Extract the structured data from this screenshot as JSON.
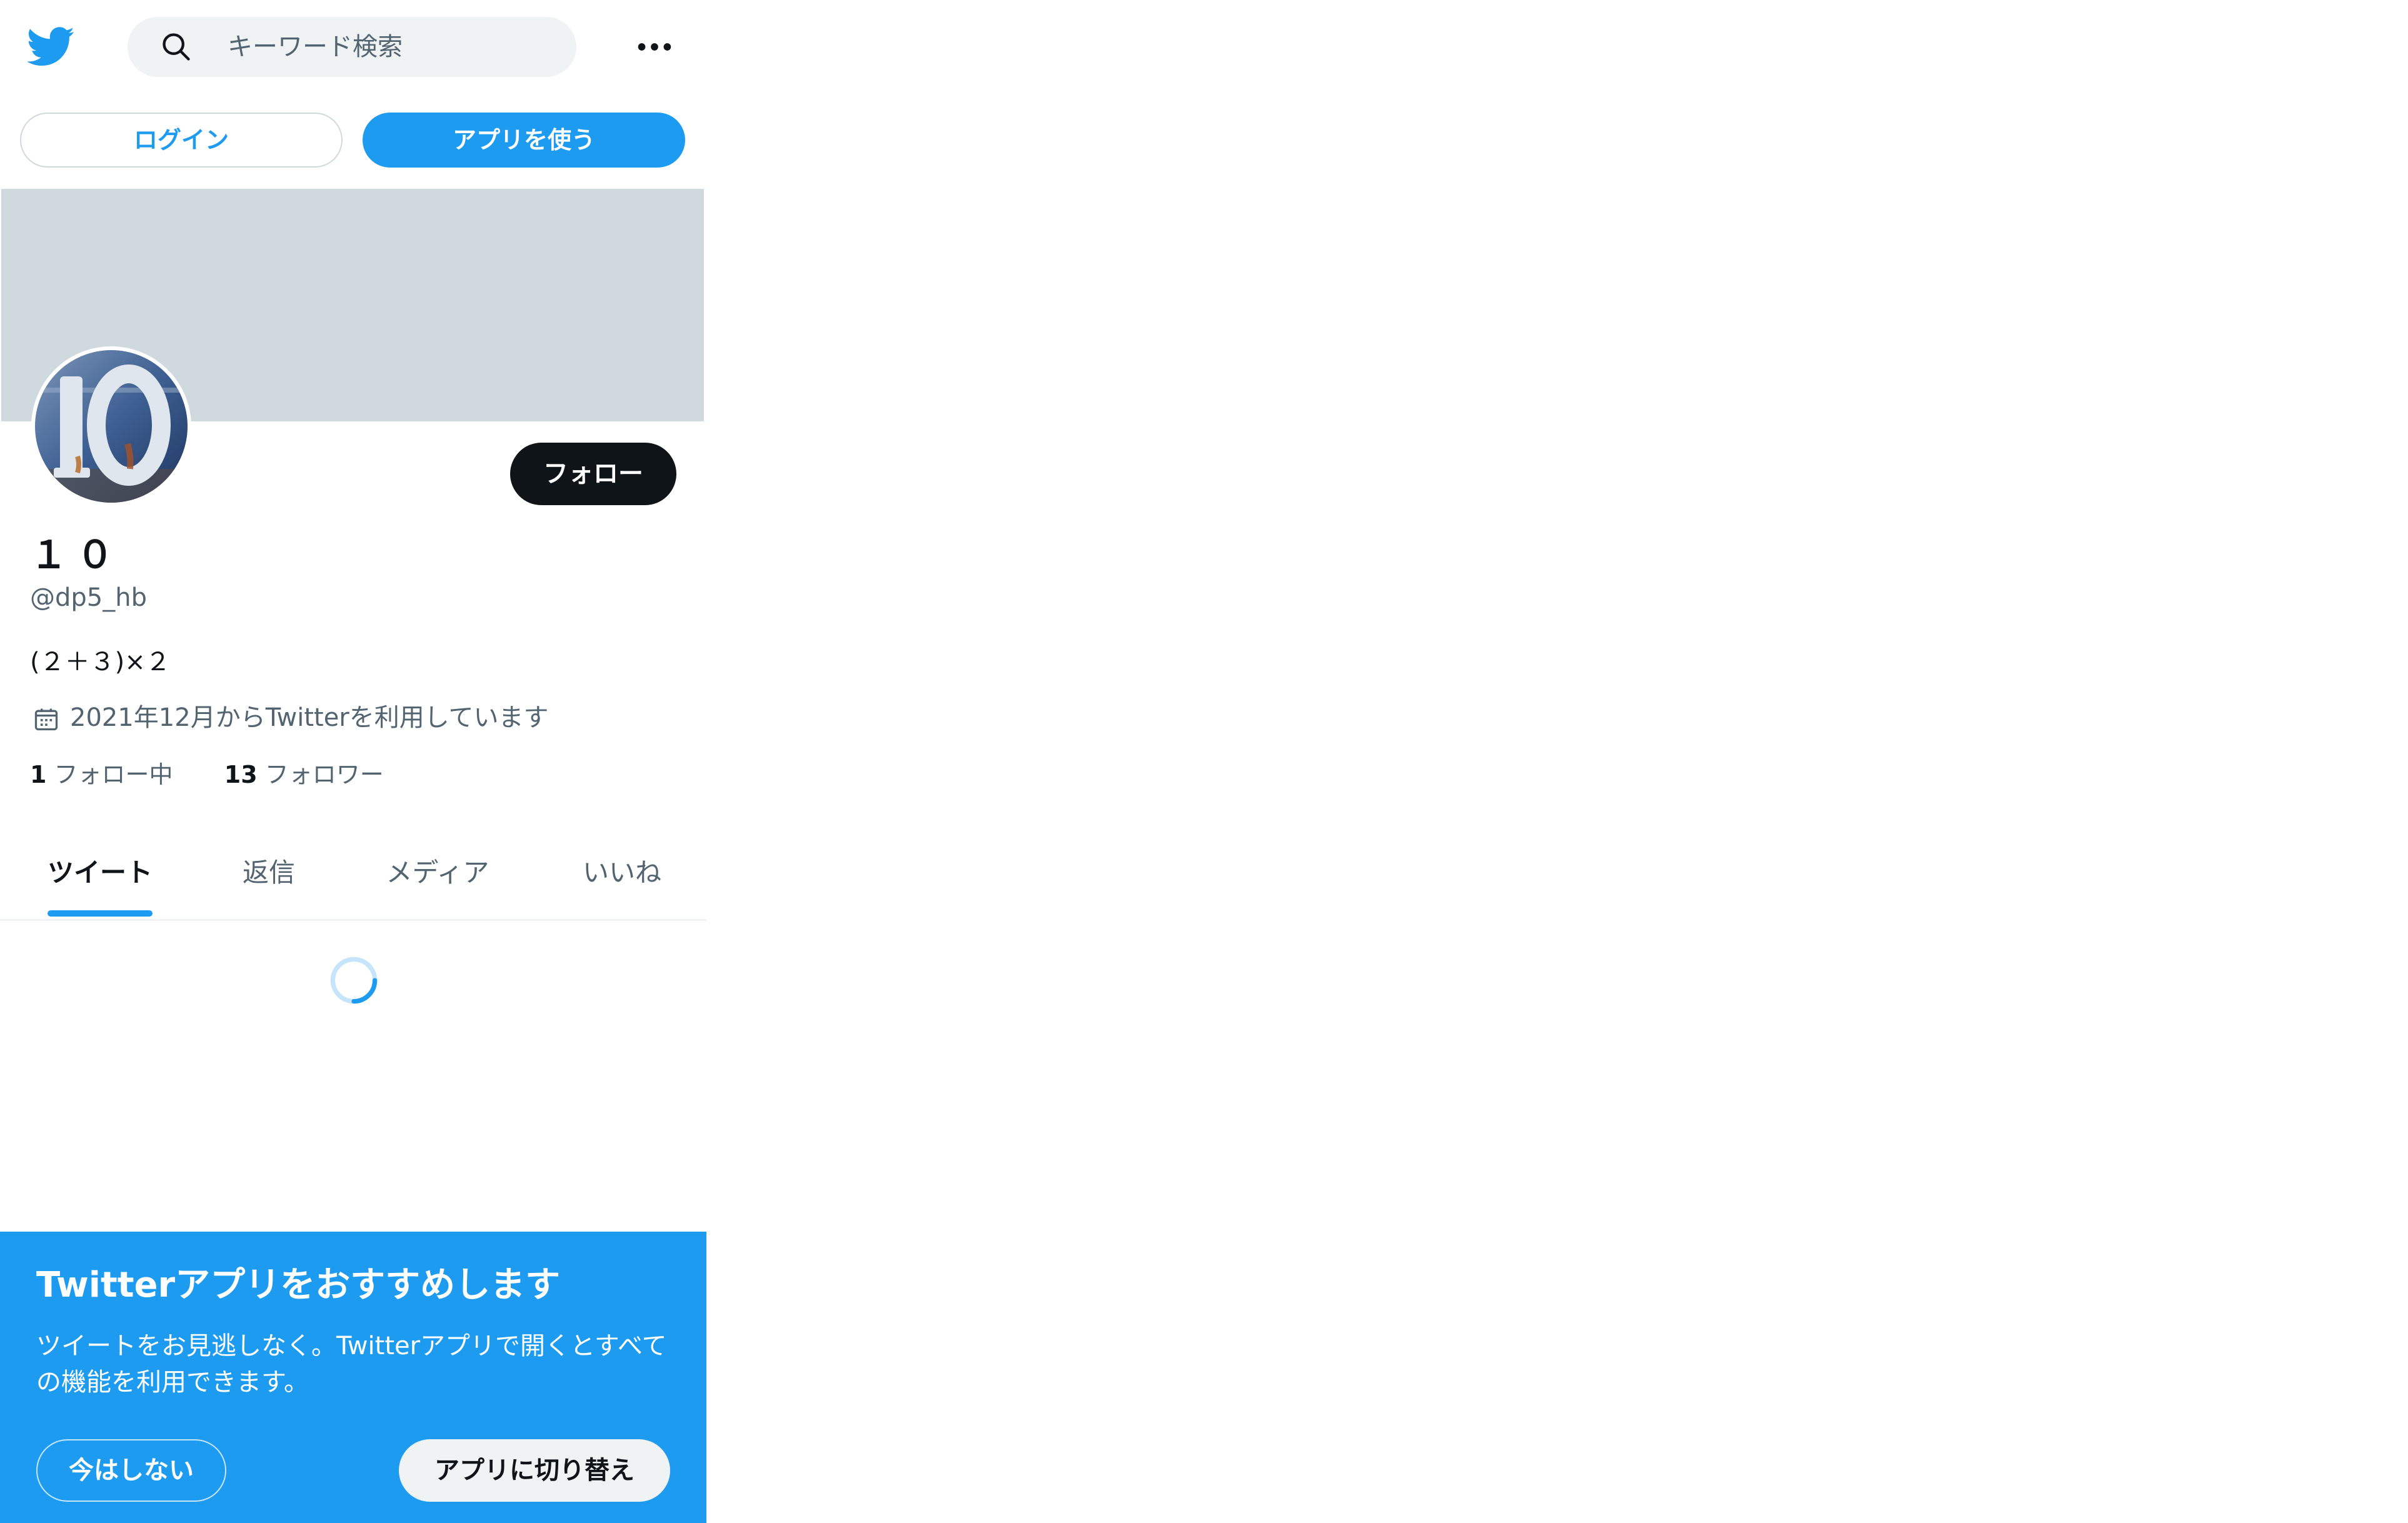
{
  "topbar": {
    "logo_icon": "twitter-bird-icon",
    "search_placeholder": "キーワード検索",
    "more_icon": "more-horizontal-icon"
  },
  "auth": {
    "login_label": "ログイン",
    "use_app_label": "アプリを使う"
  },
  "profile": {
    "name": "１０",
    "handle": "@dp5_hb",
    "bio": "(２＋３)×２",
    "joined": "2021年12月からTwitterを利用しています",
    "follow_label": "フォロー",
    "following_count": "1",
    "following_label": "フォロー中",
    "followers_count": "13",
    "followers_label": "フォロワー"
  },
  "tabs": [
    {
      "label": "ツイート",
      "active": true
    },
    {
      "label": "返信",
      "active": false
    },
    {
      "label": "メディア",
      "active": false
    },
    {
      "label": "いいね",
      "active": false
    }
  ],
  "promo": {
    "title": "Twitterアプリをおすすめします",
    "body": "ツイートをお見逃しなく。Twitterアプリで開くとすべての機能を利用できます。",
    "later_label": "今はしない",
    "switch_label": "アプリに切り替え"
  },
  "colors": {
    "accent": "#1d9bf0",
    "banner": "#cfd9de",
    "text_primary": "#0f1419",
    "text_secondary": "#536471"
  }
}
